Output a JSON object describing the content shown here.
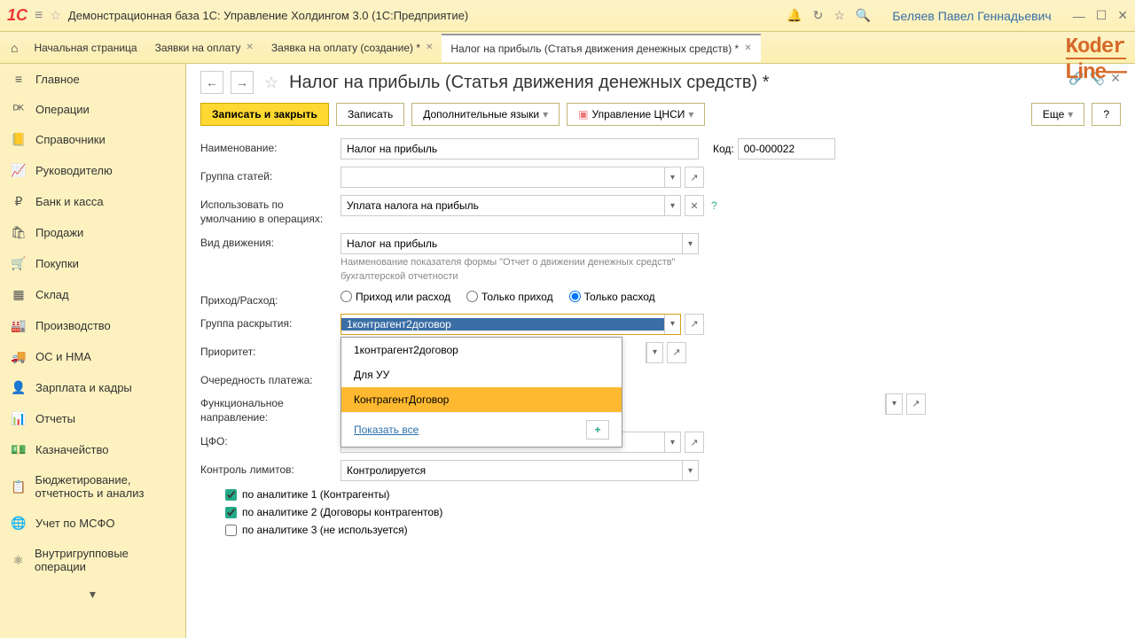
{
  "titlebar": {
    "title": "Демонстрационная база 1С: Управление Холдингом 3.0  (1С:Предприятие)",
    "user": "Беляев Павел Геннадьевич"
  },
  "tabs": {
    "home": "Начальная страница",
    "items": [
      {
        "label": "Заявки на оплату"
      },
      {
        "label": "Заявка на оплату (создание) *"
      },
      {
        "label": "Налог на прибыль (Статья движения денежных средств) *",
        "active": true
      }
    ]
  },
  "sidebar": [
    {
      "icon": "≡",
      "label": "Главное"
    },
    {
      "icon": "ᴰᴷ",
      "label": "Операции"
    },
    {
      "icon": "📒",
      "label": "Справочники"
    },
    {
      "icon": "📈",
      "label": "Руководителю"
    },
    {
      "icon": "₽",
      "label": "Банк и касса"
    },
    {
      "icon": "🛍",
      "label": "Продажи"
    },
    {
      "icon": "🛒",
      "label": "Покупки"
    },
    {
      "icon": "▦",
      "label": "Склад"
    },
    {
      "icon": "🏭",
      "label": "Производство"
    },
    {
      "icon": "🚚",
      "label": "ОС и НМА"
    },
    {
      "icon": "👤",
      "label": "Зарплата и кадры"
    },
    {
      "icon": "📊",
      "label": "Отчеты"
    },
    {
      "icon": "💵",
      "label": "Казначейство"
    },
    {
      "icon": "📋",
      "label": "Бюджетирование, отчетность и анализ"
    },
    {
      "icon": "🌐",
      "label": "Учет по МСФО"
    },
    {
      "icon": "⚛",
      "label": "Внутригрупповые операции"
    }
  ],
  "page": {
    "title": "Налог на прибыль (Статья движения денежных средств) *"
  },
  "toolbar": {
    "save_close": "Записать и закрыть",
    "save": "Записать",
    "languages": "Дополнительные языки",
    "cnsi": "Управление ЦНСИ",
    "more": "Еще"
  },
  "form": {
    "name_label": "Наименование:",
    "name_value": "Налог на прибыль",
    "code_label": "Код:",
    "code_value": "00-000022",
    "group_label": "Группа статей:",
    "usage_label": "Использовать по умолчанию в операциях:",
    "usage_value": "Уплата налога на прибыль",
    "movement_label": "Вид движения:",
    "movement_value": "Налог на прибыль",
    "movement_hint": "Наименование показателя формы \"Отчет о движении денежных средств\" бухгалтерской отчетности",
    "flow_label": "Приход/Расход:",
    "flow_options": [
      "Приход или расход",
      "Только приход",
      "Только расход"
    ],
    "disclosure_label": "Группа раскрытия:",
    "disclosure_value": "1контрагент2договор",
    "priority_label": "Приоритет:",
    "payment_order_label": "Очередность платежа:",
    "func_dir_label": "Функциональное направление:",
    "cfo_label": "ЦФО:",
    "limit_label": "Контроль лимитов:",
    "limit_value": "Контролируется",
    "analytics": [
      {
        "checked": true,
        "label": "по аналитике 1 (Контрагенты)"
      },
      {
        "checked": true,
        "label": "по аналитике 2 (Договоры контрагентов)"
      },
      {
        "checked": false,
        "label": "по аналитике 3 (не используется)"
      }
    ]
  },
  "dropdown": {
    "items": [
      "1контрагент2договор",
      "Для УУ",
      "КонтрагентДоговор"
    ],
    "selected": "КонтрагентДоговор",
    "show_all": "Показать все"
  },
  "brand": "Koder\nLine"
}
